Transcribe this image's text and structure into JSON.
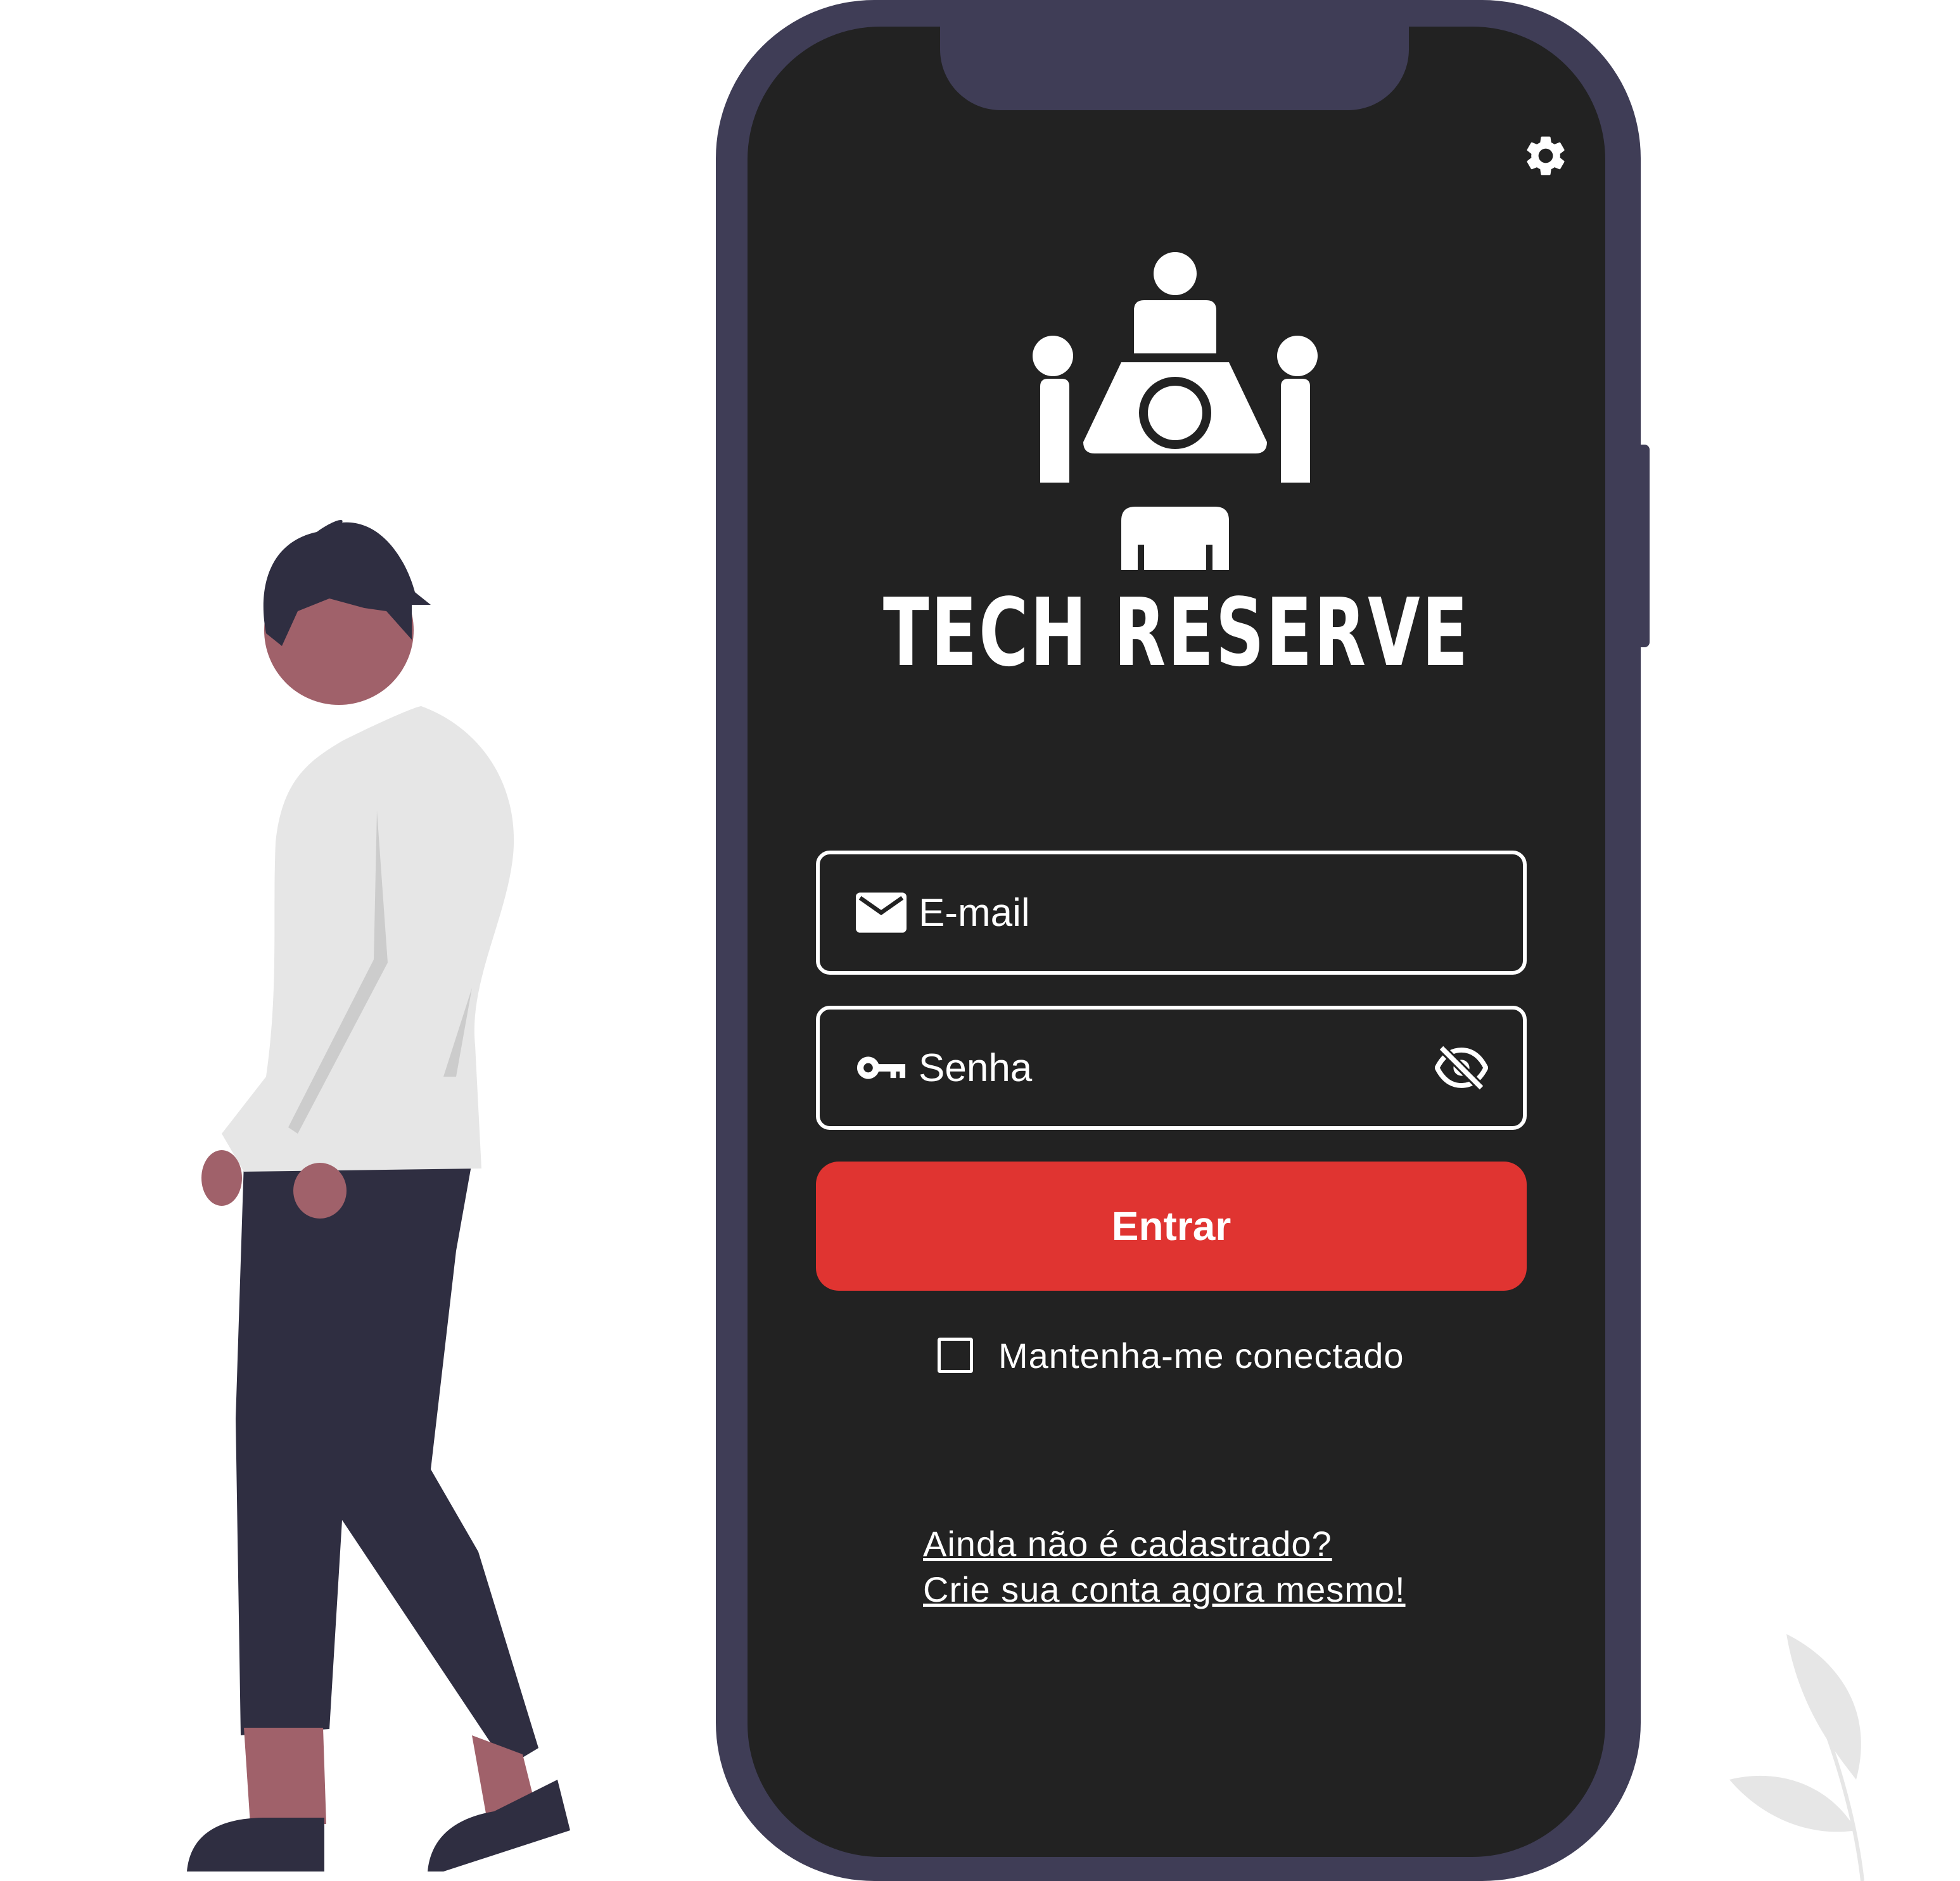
{
  "app": {
    "brand_name": "TECH RESERVE"
  },
  "login_form": {
    "email_placeholder": "E-mail",
    "password_placeholder": "Senha",
    "submit_label": "Entrar",
    "remember_me_label": "Mantenha-me conectado",
    "remember_me_checked": false
  },
  "signup": {
    "line1": "Ainda não é cadastrado?",
    "line2": "Crie sua conta agora mesmo!"
  },
  "icons": {
    "settings": "gear-icon",
    "email": "envelope-icon",
    "password": "key-icon",
    "visibility": "eye-off-icon",
    "logo": "meeting-table-logo"
  },
  "colors": {
    "phone_frame": "#3f3d56",
    "screen_background": "#222222",
    "primary_button": "#e03431",
    "text": "#ffffff",
    "person_skin": "#a0616a",
    "person_shirt": "#e6e6e6",
    "person_pants": "#2f2e41"
  }
}
